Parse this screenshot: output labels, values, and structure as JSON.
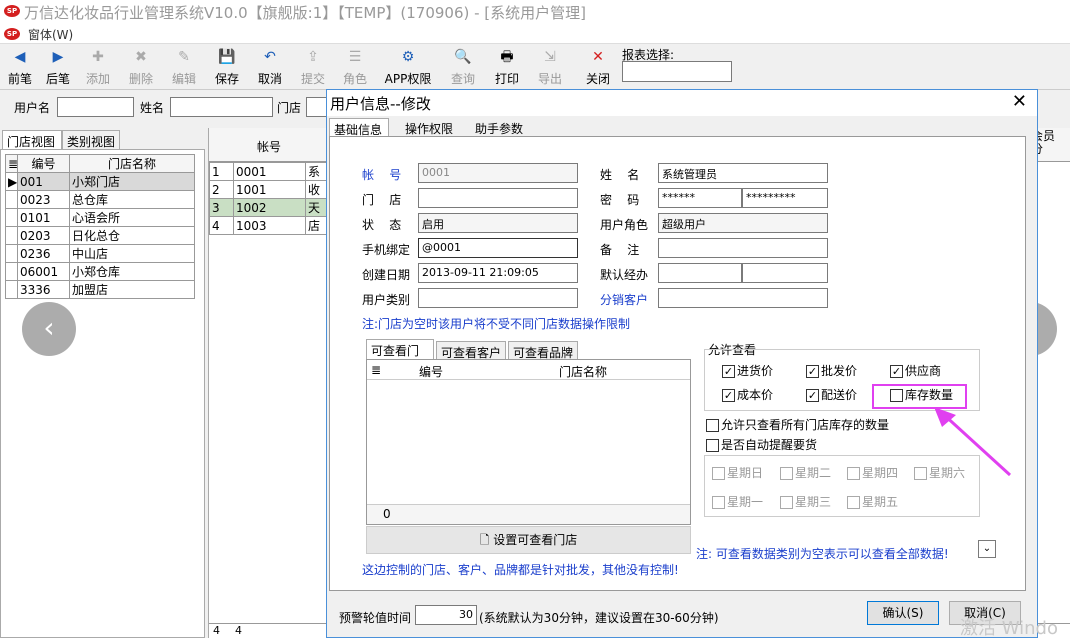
{
  "window": {
    "title": "万信达化妆品行业管理系统V10.0【旗舰版:1】【TEMP】(170906) - [系统用户管理]",
    "menu": "窗体(W)",
    "logo_text": "SP"
  },
  "toolbar": {
    "buttons": [
      {
        "label": "前笔",
        "icon": "◀"
      },
      {
        "label": "后笔",
        "icon": "▶"
      },
      {
        "label": "添加",
        "icon": "✚"
      },
      {
        "label": "删除",
        "icon": "✖"
      },
      {
        "label": "编辑",
        "icon": "✎"
      },
      {
        "label": "保存",
        "icon": "💾"
      },
      {
        "label": "取消",
        "icon": "↶"
      },
      {
        "label": "提交",
        "icon": "⇪"
      },
      {
        "label": "角色",
        "icon": "☰"
      },
      {
        "label": "APP权限",
        "icon": "⚙"
      },
      {
        "label": "查询",
        "icon": "🔍"
      },
      {
        "label": "打印",
        "icon": "🖶"
      },
      {
        "label": "导出",
        "icon": "⇲"
      },
      {
        "label": "关闭",
        "icon": "✕"
      }
    ],
    "report_label": "报表选择:"
  },
  "search": {
    "username_label": "用户名",
    "name_label": "姓名",
    "store_label": "门店"
  },
  "left_tabs": [
    "门店视图",
    "类别视图"
  ],
  "store_table": {
    "headers": [
      "编号",
      "门店名称"
    ],
    "rows": [
      [
        "001",
        "小郑门店"
      ],
      [
        "0023",
        "总仓库"
      ],
      [
        "0101",
        "心语会所"
      ],
      [
        "0203",
        "日化总仓"
      ],
      [
        "0236",
        "中山店"
      ],
      [
        "06001",
        "小郑仓库"
      ],
      [
        "3336",
        "加盟店"
      ]
    ]
  },
  "main_grid": {
    "header": "帐号",
    "right_header": "会员\n分",
    "rows": [
      {
        "idx": "1",
        "account": "0001",
        "cell": "系"
      },
      {
        "idx": "2",
        "account": "1001",
        "cell": "收"
      },
      {
        "idx": "3",
        "account": "1002",
        "cell": "天"
      },
      {
        "idx": "4",
        "account": "1003",
        "cell": "店"
      }
    ],
    "footer": [
      "4",
      "4"
    ]
  },
  "nav": {
    "prev": "‹",
    "next": "›"
  },
  "dialog": {
    "title": "用户信息--修改",
    "tabs": [
      "基础信息",
      "操作权限",
      "助手参数"
    ],
    "fields": {
      "account_label": "帐    号",
      "account_value": "0001",
      "store_label": "门    店",
      "store_value": "",
      "status_label": "状    态",
      "status_value": "启用",
      "phone_label": "手机绑定",
      "phone_value": "@0001",
      "created_label": "创建日期",
      "created_value": "2013-09-11 21:09:05",
      "usertype_label": "用户类别",
      "usertype_value": "",
      "name_label": "姓    名",
      "name_value": "系统管理员",
      "password_label": "密    码",
      "password_value": "******",
      "password_confirm": "*********",
      "role_label": "用户角色",
      "role_value": "超级用户",
      "remark_label": "备    注",
      "remark_value": "",
      "handler_label": "默认经办",
      "handler_value": "",
      "handler_value2": "",
      "dist_label": "分销客户",
      "dist_value": ""
    },
    "store_note": "注:门店为空时该用户将不受不同门店数据操作限制",
    "sub_tabs": [
      "可查看门店",
      "可查看客户",
      "可查看品牌"
    ],
    "sub_table_headers": [
      "编号",
      "门店名称"
    ],
    "sub_table_footer": "0",
    "set_store_button": "设置可查看门店",
    "bottom_note": "这边控制的门店、客户、品牌都是针对批发，其他没有控制!",
    "allow_view": {
      "title": "允许查看",
      "items": [
        {
          "label": "进货价",
          "checked": true
        },
        {
          "label": "批发价",
          "checked": true
        },
        {
          "label": "供应商",
          "checked": true
        },
        {
          "label": "成本价",
          "checked": true
        },
        {
          "label": "配送价",
          "checked": true
        },
        {
          "label": "库存数量",
          "checked": false
        }
      ]
    },
    "only_store_stock": "允许只查看所有门店库存的数量",
    "auto_remind": "是否自动提醒要货",
    "weekdays": [
      "星期日",
      "星期二",
      "星期四",
      "星期六",
      "星期一",
      "星期三",
      "星期五"
    ],
    "data_note": "注: 可查看数据类别为空表示可以查看全部数据!",
    "poll_label": "预警轮值时间",
    "poll_value": "30",
    "poll_note": "(系统默认为30分钟，建议设置在30-60分钟)",
    "ok_button": "确认(S)",
    "cancel_button": "取消(C)"
  },
  "watermark": "激活 Windo",
  "colors": {
    "highlight": "#e040f0",
    "blue_text": "#1a3ecc",
    "selected_row": "#c9dfc4"
  }
}
